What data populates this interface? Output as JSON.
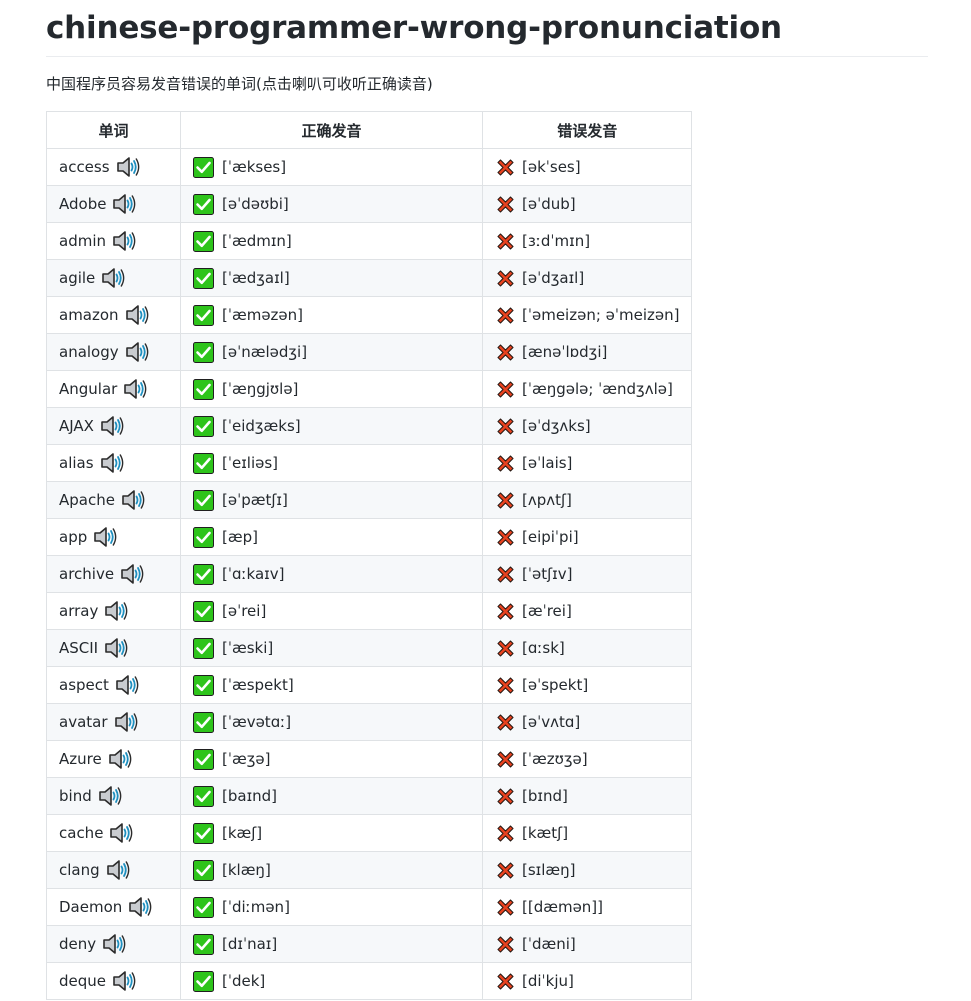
{
  "title": "chinese-programmer-wrong-pronunciation",
  "description": "中国程序员容易发音错误的单词(点击喇叭可收听正确读音)",
  "table": {
    "headers": [
      "单词",
      "正确发音",
      "错误发音"
    ],
    "rows": [
      {
        "word": "access",
        "correct": "[ˈækses]",
        "wrong": "[əkˈses]"
      },
      {
        "word": "Adobe",
        "correct": "[əˈdəʊbi]",
        "wrong": "[əˈdub]"
      },
      {
        "word": "admin",
        "correct": "[ˈædmɪn]",
        "wrong": "[ɜːdˈmɪn]"
      },
      {
        "word": "agile",
        "correct": "[ˈædʒaɪl]",
        "wrong": "[əˈdʒaɪl]"
      },
      {
        "word": "amazon",
        "correct": "[ˈæməzən]",
        "wrong": "[ˈəmeizən; əˈmeizən]"
      },
      {
        "word": "analogy",
        "correct": "[əˈnælədʒi]",
        "wrong": "[ænəˈlɒdʒi]"
      },
      {
        "word": "Angular",
        "correct": "[ˈæŋgjʊlə]",
        "wrong": "[ˈæŋgələ; ˈændʒʌlə]"
      },
      {
        "word": "AJAX",
        "correct": "[ˈeidʒæks]",
        "wrong": "[əˈdʒʌks]"
      },
      {
        "word": "alias",
        "correct": "[ˈeɪliəs]",
        "wrong": "[əˈlais]"
      },
      {
        "word": "Apache",
        "correct": "[əˈpætʃɪ]",
        "wrong": "[ʌpʌtʃ]"
      },
      {
        "word": "app",
        "correct": "[æp]",
        "wrong": "[eipiˈpi]"
      },
      {
        "word": "archive",
        "correct": "[ˈɑːkaɪv]",
        "wrong": "[ˈətʃɪv]"
      },
      {
        "word": "array",
        "correct": "[əˈrei]",
        "wrong": "[æˈrei]"
      },
      {
        "word": "ASCII",
        "correct": "[ˈæski]",
        "wrong": "[ɑːsk]"
      },
      {
        "word": "aspect",
        "correct": "[ˈæspekt]",
        "wrong": "[əˈspekt]"
      },
      {
        "word": "avatar",
        "correct": "[ˈævətɑː]",
        "wrong": "[əˈvʌtɑ]"
      },
      {
        "word": "Azure",
        "correct": "[ˈæʒə]",
        "wrong": "[ˈæzʊʒə]"
      },
      {
        "word": "bind",
        "correct": "[baɪnd]",
        "wrong": "[bɪnd]"
      },
      {
        "word": "cache",
        "correct": "[kæʃ]",
        "wrong": "[kætʃ]"
      },
      {
        "word": "clang",
        "correct": "[klæŋ]",
        "wrong": "[sɪlæŋ]"
      },
      {
        "word": "Daemon",
        "correct": "[ˈdiːmən]",
        "wrong": "[[dæmən]]"
      },
      {
        "word": "deny",
        "correct": "[dɪˈnaɪ]",
        "wrong": "[ˈdæni]"
      },
      {
        "word": "deque",
        "correct": "[ˈdek]",
        "wrong": "[diˈkju]"
      }
    ]
  },
  "colors": {
    "check_bg": "#2ec41b",
    "cross": "#e8421f",
    "border": "#dfe2e5",
    "stripe": "#f6f8fa",
    "speaker_wave": "#1e8fbf"
  },
  "icons": {
    "speaker": "speaker-icon",
    "correct": "check-mark-icon",
    "wrong": "cross-mark-icon"
  }
}
